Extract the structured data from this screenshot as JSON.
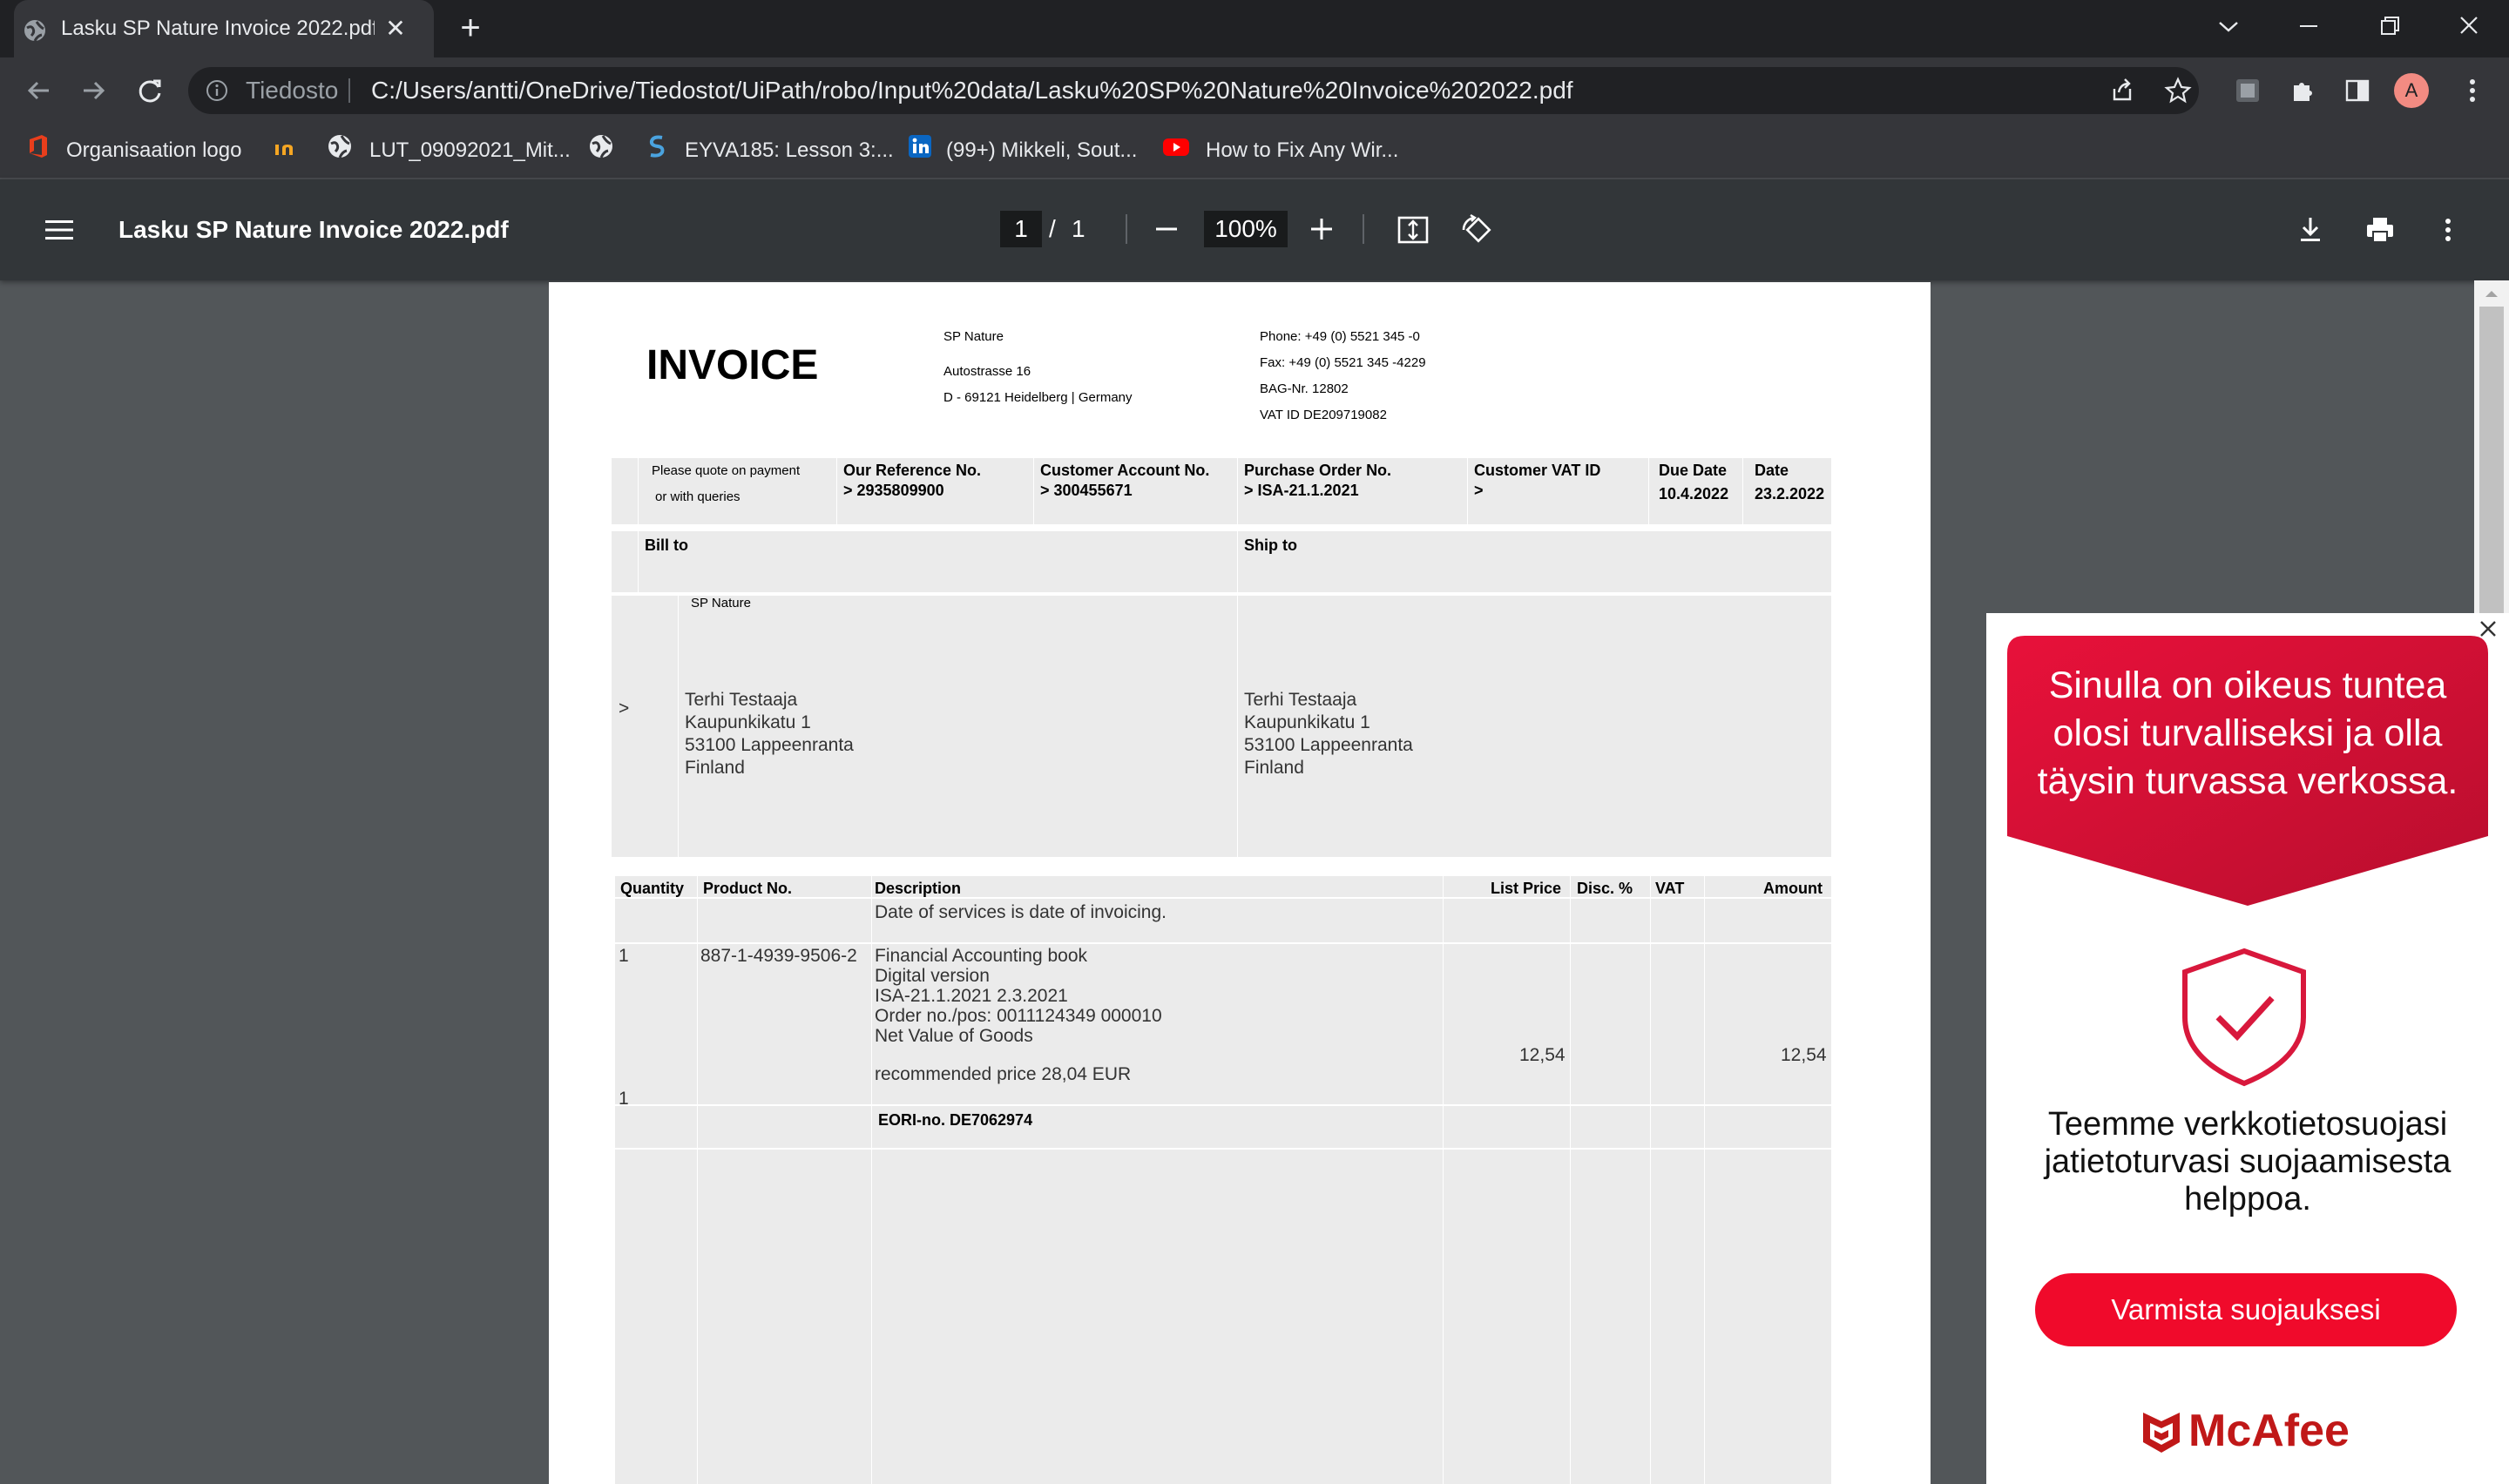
{
  "browser": {
    "tab_title": "Lasku SP Nature Invoice 2022.pdf",
    "scheme_label": "Tiedosto",
    "url": "C:/Users/antti/OneDrive/Tiedostot/UiPath/robo/Input%20data/Lasku%20SP%20Nature%20Invoice%202022.pdf",
    "avatar_letter": "A",
    "icons": [
      "globe-icon",
      "close-icon",
      "plus-icon",
      "chevron-down-icon",
      "minimize-icon",
      "restore-icon",
      "back-icon",
      "forward-icon",
      "reload-icon",
      "info-icon",
      "share-icon",
      "star-icon",
      "extension-icon",
      "puzzle-icon",
      "sidepanel-icon",
      "kebab-icon"
    ]
  },
  "bookmarks": [
    {
      "label": "Organisaation logo",
      "icon": "office-icon"
    },
    {
      "label": "",
      "icon": "in-logo-icon"
    },
    {
      "label": "LUT_09092021_Mit...",
      "icon": "globe-icon"
    },
    {
      "label": "",
      "icon": "globe-icon"
    },
    {
      "label": "EYVA185: Lesson 3:...",
      "icon": "s-logo-icon"
    },
    {
      "label": "(99+) Mikkeli, Sout...",
      "icon": "linkedin-icon"
    },
    {
      "label": "How to Fix Any Wir...",
      "icon": "youtube-icon"
    }
  ],
  "viewer": {
    "title": "Lasku SP Nature Invoice 2022.pdf",
    "page_current": "1",
    "page_separator": "/",
    "page_total": "1",
    "zoom": "100%"
  },
  "invoice": {
    "heading": "INVOICE",
    "sender": {
      "name": "SP Nature",
      "street": "Autostrasse 16",
      "city": "D - 69121 Heidelberg | Germany"
    },
    "contact": {
      "phone": "Phone: +49 (0) 5521 345 -0",
      "fax": "Fax: +49 (0) 5521 345 -4229",
      "bag": "BAG-Nr. 12802",
      "vat": "VAT ID DE209719082"
    },
    "info": {
      "quote_line1": "Please quote on payment",
      "quote_line2": "or with queries",
      "our_ref_label": "Our Reference No.",
      "our_ref_value": "> 2935809900",
      "cust_acc_label": "Customer Account No.",
      "cust_acc_value": "> 300455671",
      "po_label": "Purchase Order No.",
      "po_value": "> ISA-21.1.2021",
      "cust_vat_label": "Customer VAT ID",
      "cust_vat_value": ">",
      "due_label": "Due Date",
      "due_value": "10.4.2022",
      "date_label": "Date",
      "date_value": "23.2.2022"
    },
    "bill_to_label": "Bill to",
    "ship_to_label": "Ship to",
    "bill_company": "SP Nature",
    "bill_marker": ">",
    "bill_address": [
      "Terhi Testaaja",
      "Kaupunkikatu 1",
      "53100 Lappeenranta",
      "Finland"
    ],
    "ship_address": [
      "Terhi Testaaja",
      "Kaupunkikatu 1",
      "53100 Lappeenranta",
      "Finland"
    ],
    "table_headers": {
      "quantity": "Quantity",
      "product": "Product No.",
      "description": "Description",
      "list_price": "List Price",
      "disc": "Disc. %",
      "vat": "VAT",
      "amount": "Amount"
    },
    "services_note": "Date of services is date of invoicing.",
    "item": {
      "quantity": "1",
      "product_no": "887-1-4939-9506-2",
      "description_lines": [
        "Financial Accounting book",
        "Digital version",
        "ISA-21.1.2021 2.3.2021",
        "Order no./pos: 0011124349 000010",
        "Net Value of Goods"
      ],
      "recommended": "recommended price 28,04 EUR",
      "list_price": "12,54",
      "amount": "12,54",
      "quantity_bottom": "1"
    },
    "eori": "EORI-no. DE7062974"
  },
  "ad": {
    "headline": "Sinulla on oikeus tuntea olosi turvalliseksi ja olla täysin turvassa verkossa.",
    "body": "Teemme verkkotietosuojasi jatietoturvasi suojaamisesta helppoa.",
    "cta": "Varmista suojauksesi",
    "brand": "McAfee",
    "brand_color": "#c01818",
    "cta_color": "#f00a2b"
  }
}
